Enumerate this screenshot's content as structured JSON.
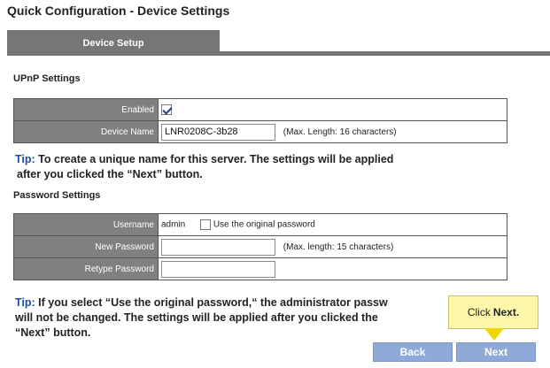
{
  "page": {
    "title": "Quick Configuration - Device Settings"
  },
  "tabs": [
    {
      "label": "Device Setup"
    }
  ],
  "upnp": {
    "heading": "UPnP Settings",
    "enabled_label": "Enabled",
    "enabled_checked": true,
    "device_name_label": "Device Name",
    "device_name_value": "LNR0208C-3b28",
    "device_name_hint": "(Max. Length: 16 characters)"
  },
  "tip1": {
    "label": "Tip:",
    "line1": "To create a unique name for this server. The settings will be applied",
    "line2": "after you clicked the “Next” button."
  },
  "password": {
    "heading": "Password Settings",
    "username_label": "Username",
    "username_value": "admin",
    "use_original_label": "Use the original password",
    "use_original_checked": false,
    "new_password_label": "New Password",
    "new_password_hint": "(Max. length: 15 characters)",
    "retype_password_label": "Retype Password"
  },
  "tip2": {
    "label": "Tip:",
    "line1": "If you select “Use the original password,“ the administrator passw",
    "line2": "will not be changed. The settings will be applied after you clicked the",
    "line3": "“Next” button."
  },
  "buttons": {
    "back": "Back",
    "next": "Next"
  },
  "callout": {
    "prefix": "Click",
    "target": "Next."
  },
  "icons": {
    "callout_pointer": "arrow-down-icon"
  },
  "colors": {
    "accent_blue": "#1a4fa0",
    "button_blue": "#8faad8",
    "header_gray": "#767676",
    "callout_yellow": "#fdf8a8"
  }
}
